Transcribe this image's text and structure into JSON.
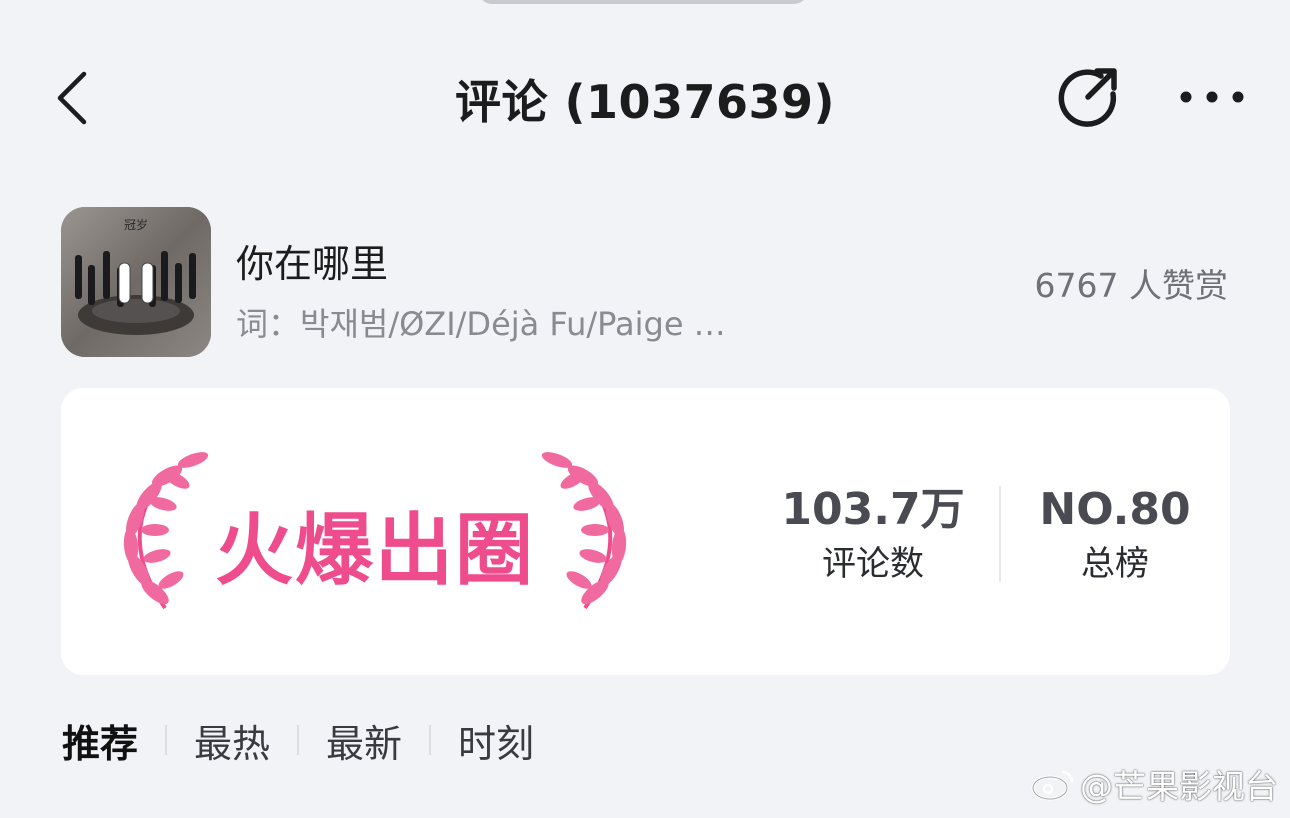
{
  "header": {
    "title": "评论 (1037639)",
    "icons": {
      "back": "chevron-left-icon",
      "share": "share-icon",
      "more": "more-icon"
    }
  },
  "song": {
    "title": "你在哪里",
    "lyricist": "词：박재범/ØZI/Déjà Fu/Paige …",
    "reward": "6767 人赞赏",
    "cover_icon": "pause-icon"
  },
  "highlight": {
    "badge": "火爆出圈",
    "badge_color": "#ef4c8e",
    "stats": [
      {
        "value": "103.7万",
        "label": "评论数"
      },
      {
        "value": "NO.80",
        "label": "总榜"
      }
    ]
  },
  "tabs": [
    {
      "label": "推荐",
      "active": true
    },
    {
      "label": "最热",
      "active": false
    },
    {
      "label": "最新",
      "active": false
    },
    {
      "label": "时刻",
      "active": false
    }
  ],
  "watermark": {
    "text": "@芒果影视台",
    "icon": "weibo-icon"
  }
}
